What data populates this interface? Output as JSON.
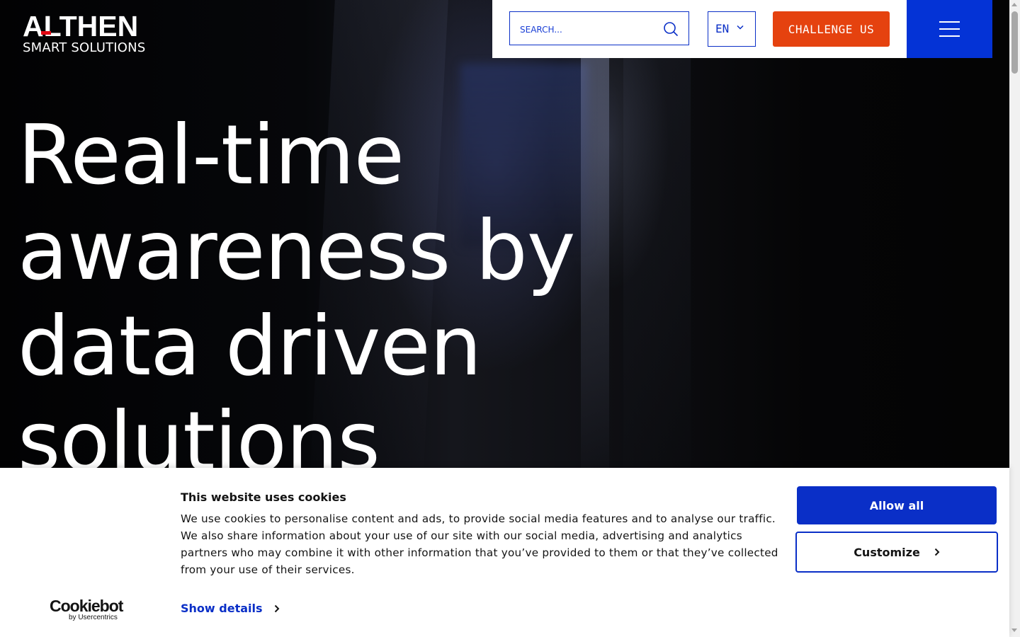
{
  "brand": {
    "logo_main": "ALTHEN",
    "logo_sub": "SMART SOLUTIONS"
  },
  "header": {
    "search_placeholder": "SEARCH...",
    "language": "EN",
    "cta_label": "CHALLENGE US",
    "colors": {
      "primary_blue": "#0433d6",
      "cta_orange": "#e5420f"
    }
  },
  "hero": {
    "headline": "Real-time awareness by data driven solutions"
  },
  "cookie_banner": {
    "title": "This website uses cookies",
    "text": "We use cookies to personalise content and ads, to provide social media features and to analyse our traffic. We also share information about your use of our site with our social media, advertising and analytics partners who may combine it with other information that you’ve provided to them or that they’ve collected from your use of their services.",
    "show_details_label": "Show details",
    "allow_all_label": "Allow all",
    "customize_label": "Customize",
    "provider_logo": "Cookiebot",
    "provider_sub": "by Usercentrics"
  }
}
